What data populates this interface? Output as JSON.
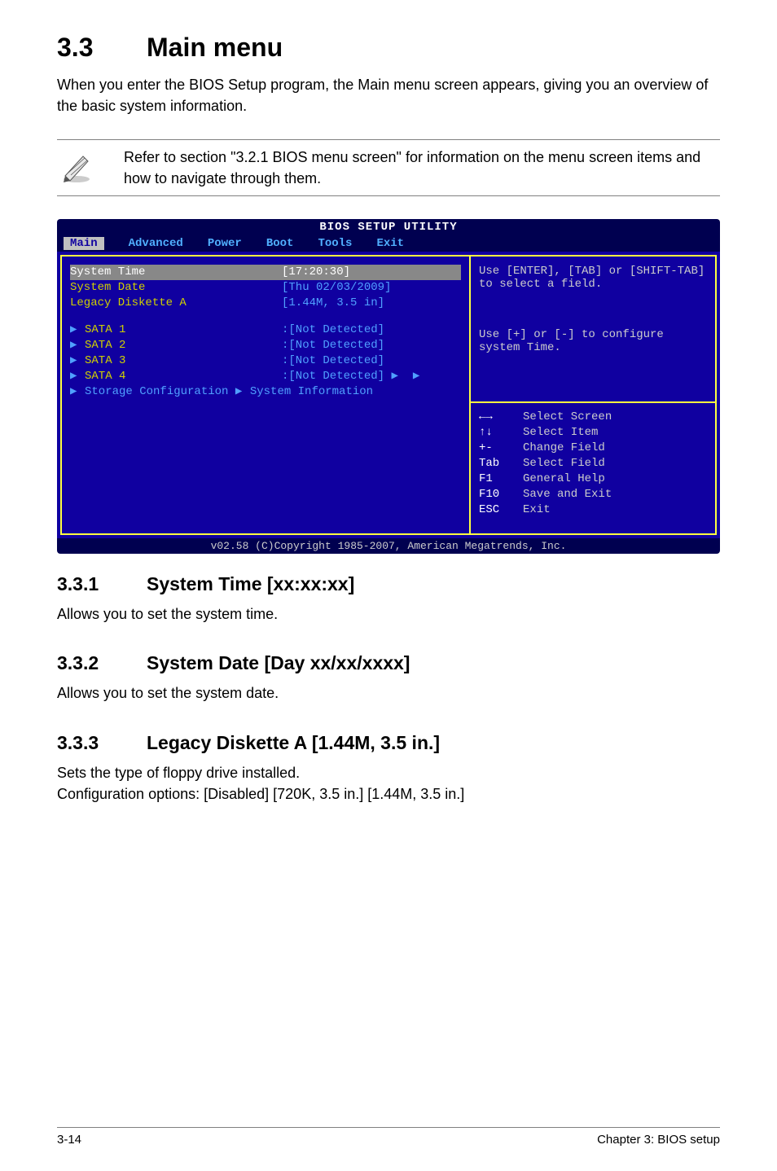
{
  "section": {
    "number": "3.3",
    "title": "Main menu"
  },
  "intro": "When you enter the BIOS Setup program, the Main menu screen appears, giving you an overview of the basic system information.",
  "note": "Refer to section \"3.2.1 BIOS menu screen\" for information on the menu screen items and how to navigate through them.",
  "bios": {
    "header": "BIOS SETUP UTILITY",
    "menus": [
      "Main",
      "Advanced",
      "Power",
      "Boot",
      "Tools",
      "Exit"
    ],
    "selected_menu": "Main",
    "fields": {
      "system_time_label": "System Time",
      "system_time_value": "[17:20:30]",
      "system_date_label": "System Date",
      "system_date_value": "[Thu 02/03/2009]",
      "legacy_label": "Legacy Diskette A",
      "legacy_value": "[1.44M, 3.5 in]"
    },
    "sata": [
      {
        "label": "SATA 1",
        "value": ":[Not Detected]"
      },
      {
        "label": "SATA 2",
        "value": ":[Not Detected]"
      },
      {
        "label": "SATA 3",
        "value": ":[Not Detected]"
      },
      {
        "label": "SATA 4",
        "value": ":[Not Detected]"
      }
    ],
    "submenus": [
      "Storage Configuration",
      "System Information"
    ],
    "help1": "Use [ENTER], [TAB] or [SHIFT-TAB] to select a field.",
    "help2": "Use [+] or [-] to configure system Time.",
    "keys": [
      {
        "k": "←→",
        "d": "Select Screen"
      },
      {
        "k": "↑↓",
        "d": "Select Item"
      },
      {
        "k": "+-",
        "d": "Change Field"
      },
      {
        "k": "Tab",
        "d": "Select Field"
      },
      {
        "k": "F1",
        "d": "General Help"
      },
      {
        "k": "F10",
        "d": "Save and Exit"
      },
      {
        "k": "ESC",
        "d": "Exit"
      }
    ],
    "footer": "v02.58 (C)Copyright 1985-2007, American Megatrends, Inc."
  },
  "sub1": {
    "num": "3.3.1",
    "title": "System Time [xx:xx:xx]",
    "text": "Allows you to set the system time."
  },
  "sub2": {
    "num": "3.3.2",
    "title": "System Date [Day xx/xx/xxxx]",
    "text": "Allows you to set the system date."
  },
  "sub3": {
    "num": "3.3.3",
    "title": "Legacy Diskette A [1.44M, 3.5 in.]",
    "text1": "Sets the type of floppy drive installed.",
    "text2": "Configuration options: [Disabled] [720K, 3.5 in.] [1.44M, 3.5 in.]"
  },
  "pgfooter": {
    "left": "3-14",
    "right": "Chapter 3: BIOS setup"
  }
}
